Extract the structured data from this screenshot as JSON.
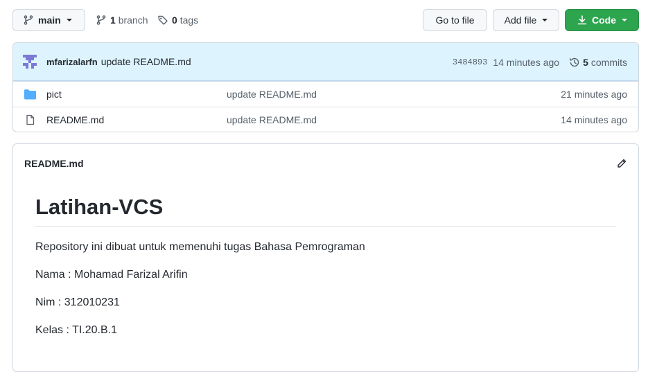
{
  "toolbar": {
    "branch_button": "main",
    "branch_count": "1",
    "branch_label": "branch",
    "tag_count": "0",
    "tag_label": "tags",
    "go_to_file": "Go to file",
    "add_file": "Add file",
    "code": "Code"
  },
  "commit": {
    "author": "mfarizalarfn",
    "message": "update README.md",
    "sha": "3484893",
    "time": "14 minutes ago",
    "commit_count": "5",
    "commit_label": "commits"
  },
  "files": [
    {
      "name": "pict",
      "type": "folder",
      "message": "update README.md",
      "age": "21 minutes ago"
    },
    {
      "name": "README.md",
      "type": "file",
      "message": "update README.md",
      "age": "14 minutes ago"
    }
  ],
  "readme": {
    "filename": "README.md",
    "heading": "Latihan-VCS",
    "paragraphs": [
      "Repository ini dibuat untuk memenuhi tugas Bahasa Pemrograman",
      "Nama : Mohamad Farizal Arifin",
      "Nim : 312010231",
      "Kelas : TI.20.B.1"
    ]
  },
  "colors": {
    "primary_button": "#2da44e",
    "commit_bar": "#ddf4ff",
    "folder_icon": "#54aeff",
    "avatar": "#7b78d8"
  }
}
